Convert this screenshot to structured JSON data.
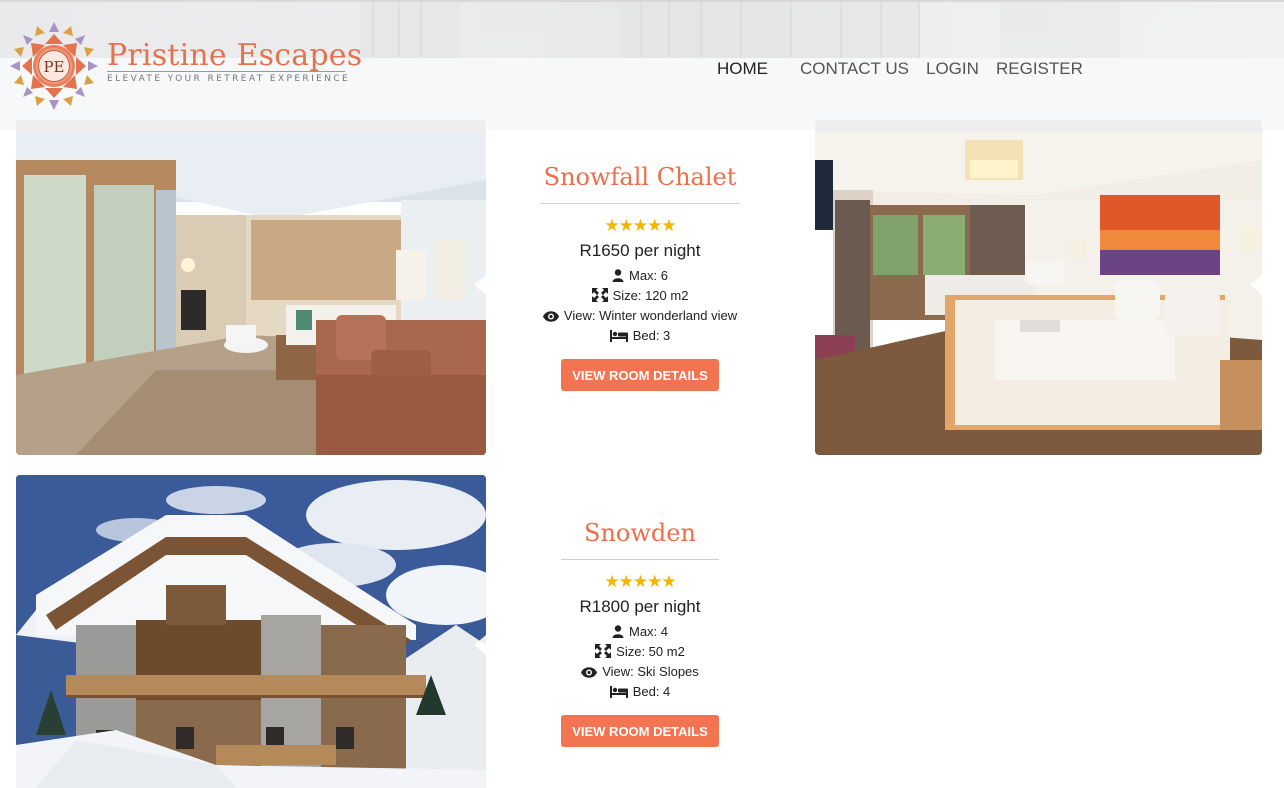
{
  "brand": {
    "monogram": "PE",
    "name": "Pristine Escapes",
    "tagline": "ELEVATE YOUR RETREAT EXPERIENCE",
    "primary_color": "#e3734f"
  },
  "nav": {
    "items": [
      {
        "label": "HOME",
        "active": true
      },
      {
        "label": "CONTACT US",
        "active": false
      },
      {
        "label": "LOGIN",
        "active": false
      },
      {
        "label": "REGISTER",
        "active": false
      }
    ]
  },
  "rooms": [
    {
      "name": "Snowfall Chalet",
      "rating": 5,
      "stars": "★★★★★",
      "price": "R1650 per night",
      "max": "Max: 6",
      "size": "Size: 120 m2",
      "view": "View: Winter wonderland view",
      "bed": "Bed: 3",
      "button": "VIEW ROOM DETAILS"
    },
    {
      "name": "Snowden",
      "rating": 5,
      "stars": "★★★★★",
      "price": "R1800 per night",
      "max": "Max: 4",
      "size": "Size: 50 m2",
      "view": "View: Ski Slopes",
      "bed": "Bed: 4",
      "button": "VIEW ROOM DETAILS"
    }
  ],
  "icons": {
    "max": "user-icon",
    "size": "expand-arrows-icon",
    "view": "eye-icon",
    "bed": "bed-icon",
    "prev": "chevron-left-icon"
  },
  "colors": {
    "accent": "#f37450",
    "title": "#ec6e4b",
    "stars": "#f3b600"
  }
}
